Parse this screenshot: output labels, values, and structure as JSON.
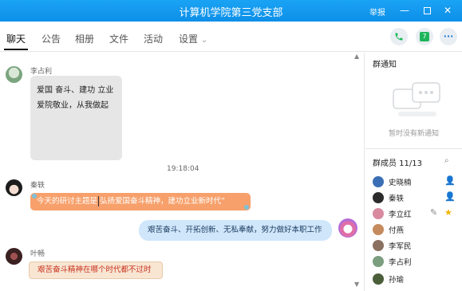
{
  "window": {
    "title": "计算机学院第三党支部",
    "report_label": "举报",
    "min_glyph": "—",
    "close_glyph": "✕"
  },
  "tabs": [
    {
      "label": "聊天",
      "active": true
    },
    {
      "label": "公告"
    },
    {
      "label": "相册"
    },
    {
      "label": "文件"
    },
    {
      "label": "活动"
    },
    {
      "label": "设置"
    }
  ],
  "settings_chevron": "⌄",
  "header_icons": {
    "phone": "phone-icon",
    "calendar": "calendar-icon",
    "calendar_day": "7",
    "more": "more-icon",
    "more_glyph": "···"
  },
  "messages": [
    {
      "sender": "李占利",
      "lines": [
        "爱国 奋斗、建功 立业",
        "爱院敬业，从我做起"
      ],
      "style": "gray"
    },
    {
      "timestamp": "19:18:04"
    },
    {
      "sender": "秦轶",
      "text_before": "今天的研讨主题是",
      "text_after": "弘扬爱国奋斗精神，建功立业新时代”",
      "style": "orange"
    },
    {
      "text": "艰苦奋斗、开拓创新、无私奉献，努力做好本职工作",
      "style": "blue"
    },
    {
      "sender": "叶畅",
      "text": "艰苦奋斗精神在哪个时代都不过时",
      "style": "beige"
    }
  ],
  "scroll": {
    "up": "▲",
    "down": "▼"
  },
  "notice": {
    "title": "群通知",
    "empty_text": "暂时没有新通知"
  },
  "members": {
    "title": "群成员 11/13",
    "search_icon": "search-icon",
    "search_glyph": "⌕",
    "list": [
      {
        "name": "史晓楠",
        "color": "#3b6fb5",
        "badge": "admin-icon"
      },
      {
        "name": "秦轶",
        "color": "#2b2b2b",
        "badge": "admin-icon"
      },
      {
        "name": "李立红",
        "color": "#d98a9e",
        "badge": "owner-star-icon",
        "edit": "edit-icon"
      },
      {
        "name": "付燕",
        "color": "#c58b5e"
      },
      {
        "name": "李军民",
        "color": "#8a7060"
      },
      {
        "name": "李占利",
        "color": "#7a9e7e"
      },
      {
        "name": "孙瑜",
        "color": "#4a5e3a"
      }
    ],
    "icon_glyphs": {
      "admin": "👤",
      "star": "★",
      "edit": "✎"
    }
  },
  "colors": {
    "titlebar": "#1aa3f5",
    "bubble_orange": "#f7a06b",
    "bubble_blue": "#cfe6fb",
    "bubble_beige": "#f8e5d2",
    "admin_green": "#3eb84a",
    "star_gold": "#f5b400"
  }
}
